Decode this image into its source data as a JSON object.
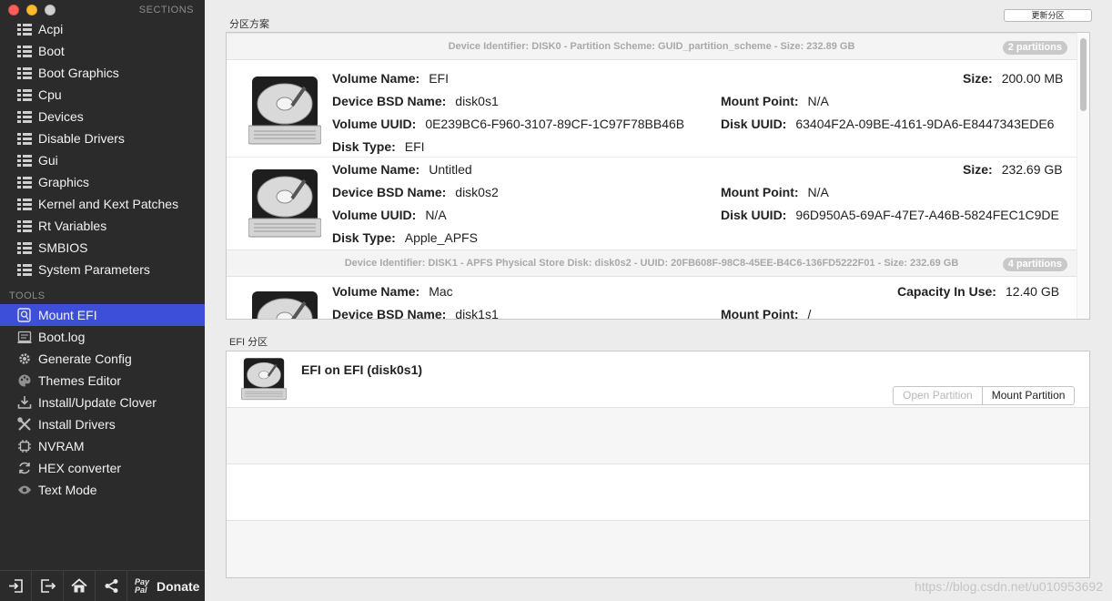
{
  "sidebar": {
    "sections_heading": "SECTIONS",
    "tools_heading": "TOOLS",
    "sections": [
      {
        "label": "Acpi"
      },
      {
        "label": "Boot"
      },
      {
        "label": "Boot Graphics"
      },
      {
        "label": "Cpu"
      },
      {
        "label": "Devices"
      },
      {
        "label": "Disable Drivers"
      },
      {
        "label": "Gui"
      },
      {
        "label": "Graphics"
      },
      {
        "label": "Kernel and Kext Patches"
      },
      {
        "label": "Rt Variables"
      },
      {
        "label": "SMBIOS"
      },
      {
        "label": "System Parameters"
      }
    ],
    "tools": [
      {
        "label": "Mount EFI",
        "icon": "mount-efi-icon",
        "active": true
      },
      {
        "label": "Boot.log",
        "icon": "log-icon"
      },
      {
        "label": "Generate Config",
        "icon": "gear-icon"
      },
      {
        "label": "Themes Editor",
        "icon": "palette-icon"
      },
      {
        "label": "Install/Update Clover",
        "icon": "install-icon"
      },
      {
        "label": "Install Drivers",
        "icon": "tools-icon"
      },
      {
        "label": "NVRAM",
        "icon": "chip-icon"
      },
      {
        "label": "HEX converter",
        "icon": "refresh-icon"
      },
      {
        "label": "Text Mode",
        "icon": "eye-icon"
      }
    ],
    "bottom": {
      "paypal_top": "Pay",
      "paypal_bottom": "Pal",
      "donate_label": "Donate"
    }
  },
  "main": {
    "partition_section_label": "分区方案",
    "refresh_button": "更新分区",
    "disks": [
      {
        "header": "Device Identifier: DISK0 - Partition Scheme: GUID_partition_scheme - Size: 232.89 GB",
        "badge": "2 partitions"
      },
      {
        "header": "Device Identifier: DISK1 - APFS Physical Store Disk: disk0s2 - UUID: 20FB608F-98C8-45EE-B4C6-136FD5222F01 - Size: 232.69 GB",
        "badge": "4 partitions"
      }
    ],
    "labels": {
      "volume_name": "Volume Name:",
      "device_bsd_name": "Device BSD Name:",
      "volume_uuid": "Volume UUID:",
      "disk_type": "Disk Type:",
      "size": "Size:",
      "mount_point": "Mount Point:",
      "disk_uuid": "Disk UUID:",
      "capacity_in_use": "Capacity In Use:"
    },
    "volumes": [
      {
        "volume_name": "EFI",
        "device_bsd_name": "disk0s1",
        "volume_uuid": "0E239BC6-F960-3107-89CF-1C97F78BB46B",
        "disk_type": "EFI",
        "size": "200.00 MB",
        "mount_point": "N/A",
        "disk_uuid": "63404F2A-09BE-4161-9DA6-E8447343EDE6"
      },
      {
        "volume_name": "Untitled",
        "device_bsd_name": "disk0s2",
        "volume_uuid": "N/A",
        "disk_type": "Apple_APFS",
        "size": "232.69 GB",
        "mount_point": "N/A",
        "disk_uuid": "96D950A5-69AF-47E7-A46B-5824FEC1C9DE"
      },
      {
        "volume_name": "Mac",
        "device_bsd_name": "disk1s1",
        "capacity_in_use": "12.40 GB",
        "mount_point": "/"
      }
    ],
    "efi_section_label": "EFI 分区",
    "efi_title": "EFI on EFI (disk0s1)",
    "open_partition": "Open Partition",
    "mount_partition": "Mount Partition",
    "watermark": "https://blog.csdn.net/u010953692"
  }
}
